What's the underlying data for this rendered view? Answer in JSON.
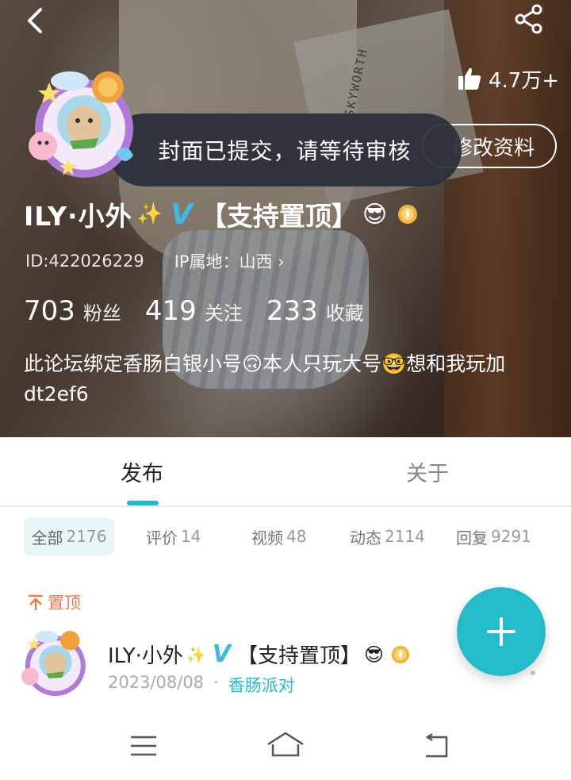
{
  "header": {
    "likes": "4.7万+",
    "edit_label": "修改资料",
    "toast": "封面已提交，请等待审核",
    "cover_text": "SKYWORTH"
  },
  "profile": {
    "name": "ILY·小外",
    "name_emoji": "✨",
    "tag": "【支持置顶】",
    "tag_emoji": "😎",
    "id_text": "ID:422026229",
    "ip_text": "IP属地：山西 ›",
    "stats": [
      {
        "num": "703",
        "label": "粉丝"
      },
      {
        "num": "419",
        "label": "关注"
      },
      {
        "num": "233",
        "label": "收藏"
      }
    ],
    "bio": "此论坛绑定香肠白银小号🙃本人只玩大号🤓想和我玩加dt2ef6"
  },
  "tabs": {
    "publish": "发布",
    "about": "关于"
  },
  "filters": [
    {
      "label": "全部",
      "count": "2176"
    },
    {
      "label": "评价",
      "count": "14"
    },
    {
      "label": "视频",
      "count": "48"
    },
    {
      "label": "动态",
      "count": "2114"
    },
    {
      "label": "回复",
      "count": "9291"
    }
  ],
  "pinned_label": "置顶",
  "post": {
    "name": "ILY·小外",
    "name_emoji": "✨",
    "tag": "【支持置顶】",
    "tag_emoji": "😎",
    "date": "2023/08/08",
    "separator": "·",
    "forum": "香肠派对"
  },
  "colors": {
    "accent": "#20bccb",
    "pinned": "#f07a4e",
    "vbadge": "#40b8e6"
  },
  "icons": {
    "back": "chevron-left-icon",
    "share": "share-icon",
    "like": "thumbs-up-icon",
    "fab": "plus-icon",
    "nav": [
      "menu-icon",
      "home-icon",
      "back-icon"
    ]
  }
}
